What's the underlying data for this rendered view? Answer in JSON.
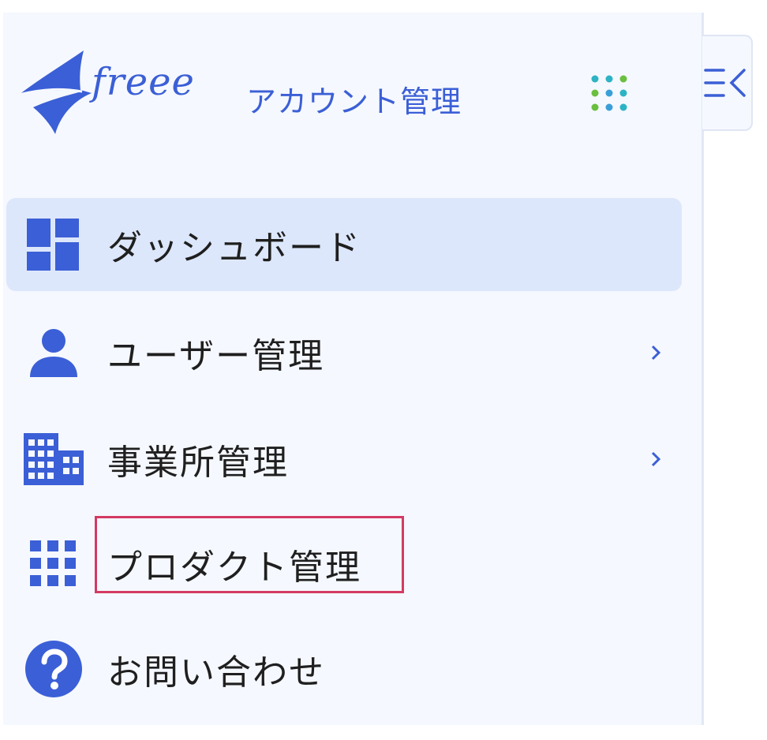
{
  "header": {
    "logo_text": "freee",
    "app_name": "アカウント管理",
    "app_switcher_icon": "app-grid-icon",
    "collapse_icon": "collapse-sidebar-icon"
  },
  "nav": {
    "items": [
      {
        "label": "ダッシュボード",
        "icon": "dashboard-icon",
        "active": true,
        "has_children": false
      },
      {
        "label": "ユーザー管理",
        "icon": "person-icon",
        "active": false,
        "has_children": true
      },
      {
        "label": "事業所管理",
        "icon": "building-icon",
        "active": false,
        "has_children": true
      },
      {
        "label": "プロダクト管理",
        "icon": "apps-grid-icon",
        "active": false,
        "has_children": false
      },
      {
        "label": "お問い合わせ",
        "icon": "help-icon",
        "active": false,
        "has_children": false
      }
    ]
  },
  "colors": {
    "brand": "#3b5fd6",
    "sidebar_bg": "#f5f8fe",
    "active_bg": "#dde7fb",
    "highlight": "#d43a62"
  }
}
